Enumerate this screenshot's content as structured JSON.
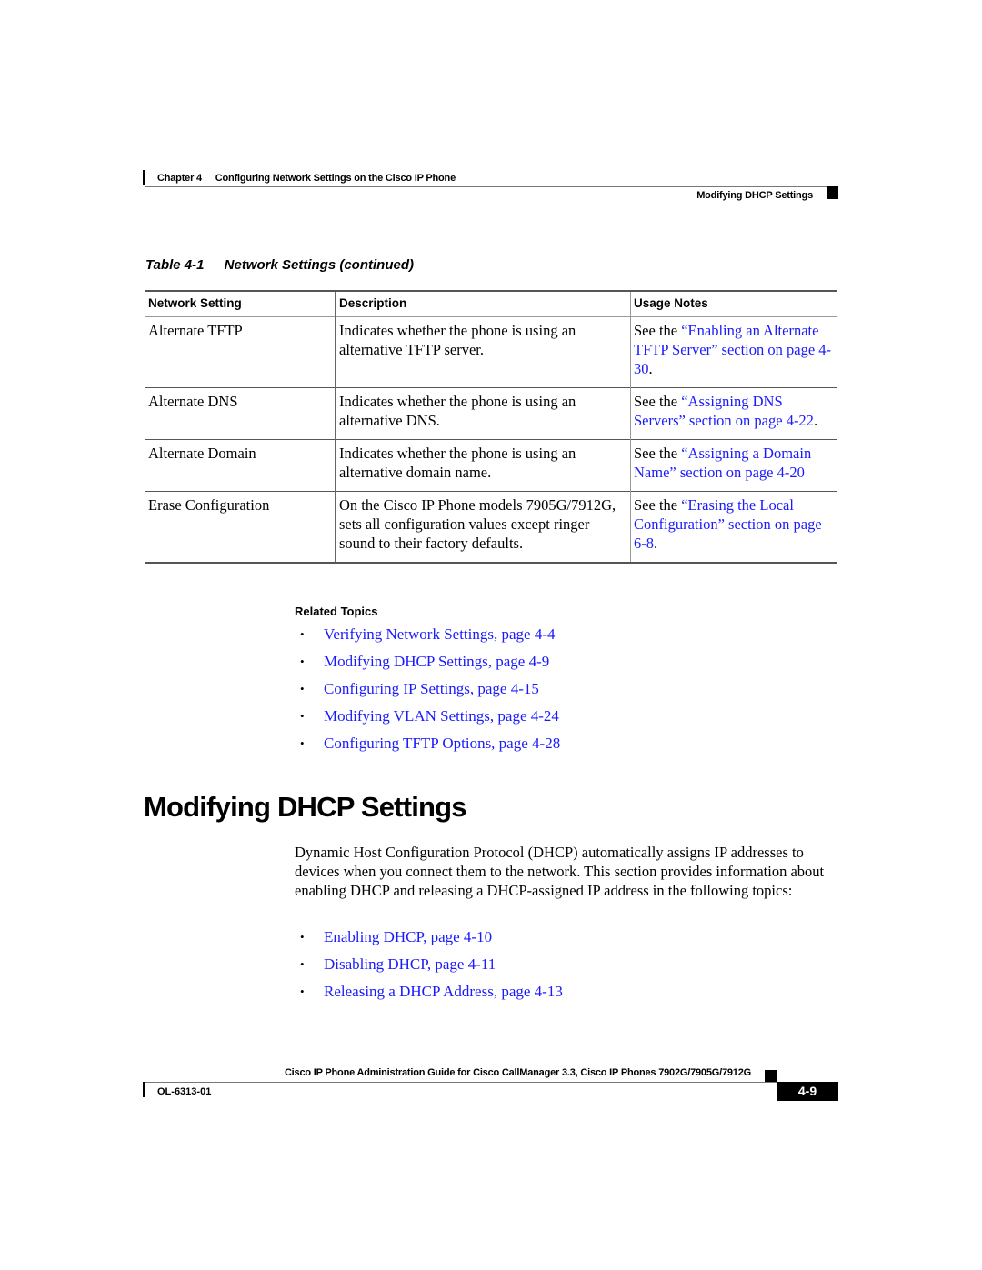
{
  "header": {
    "chapter_label": "Chapter 4",
    "chapter_title": "Configuring Network Settings on the Cisco IP Phone",
    "section_title": "Modifying DHCP Settings"
  },
  "table": {
    "caption_number": "Table 4-1",
    "caption_title": "Network Settings (continued)",
    "columns": [
      "Network Setting",
      "Description",
      "Usage Notes"
    ],
    "rows": [
      {
        "setting": "Alternate TFTP",
        "description": "Indicates whether the phone is using an alternative TFTP server.",
        "notes_prefix": "See the ",
        "notes_link": "“Enabling an Alternate TFTP Server” section on page 4-30",
        "notes_suffix": "."
      },
      {
        "setting": "Alternate DNS",
        "description": "Indicates whether the phone is using an alternative DNS.",
        "notes_prefix": "See the ",
        "notes_link": "“Assigning DNS Servers” section on page 4-22",
        "notes_suffix": "."
      },
      {
        "setting": "Alternate Domain",
        "description": "Indicates whether the phone is using an alternative domain name.",
        "notes_prefix": "See the ",
        "notes_link": "“Assigning a Domain Name” section on page 4-20",
        "notes_suffix": ""
      },
      {
        "setting": "Erase Configuration",
        "description": "On the Cisco IP Phone models 7905G/7912G, sets all configuration values except ringer sound to their factory defaults.",
        "notes_prefix": "See the ",
        "notes_link": "“Erasing the Local Configuration” section on page 6-8",
        "notes_suffix": "."
      }
    ]
  },
  "related_topics": {
    "heading": "Related Topics",
    "bullet": "•",
    "items": [
      "Verifying Network Settings, page 4-4",
      "Modifying DHCP Settings, page 4-9",
      "Configuring IP Settings, page 4-15",
      "Modifying VLAN Settings, page 4-24",
      "Configuring TFTP Options, page 4-28"
    ]
  },
  "section": {
    "heading": "Modifying DHCP Settings",
    "paragraph": "Dynamic Host Configuration Protocol (DHCP) automatically assigns IP addresses to devices when you connect them to the network. This section provides information about enabling DHCP and releasing a DHCP-assigned IP address in the following topics:",
    "topics": [
      "Enabling DHCP, page 4-10",
      "Disabling DHCP, page 4-11",
      "Releasing a DHCP Address, page 4-13"
    ]
  },
  "footer": {
    "guide_title": "Cisco IP Phone Administration Guide for Cisco CallManager 3.3, Cisco IP Phones 7902G/7905G/7912G",
    "doc_number": "OL-6313-01",
    "page_number": "4-9"
  },
  "colors": {
    "link": "#1a1aff",
    "text": "#000000"
  }
}
